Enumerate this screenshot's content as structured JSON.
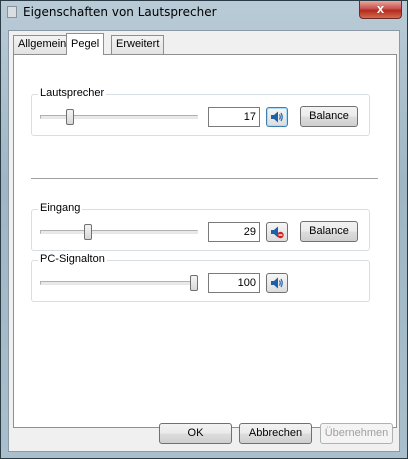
{
  "window": {
    "title": "Eigenschaften von Lautsprecher",
    "close_label": "x"
  },
  "tabs": [
    {
      "label": "Allgemein",
      "active": false
    },
    {
      "label": "Pegel",
      "active": true
    },
    {
      "label": "Erweitert",
      "active": false
    }
  ],
  "groups": {
    "speaker": {
      "label": "Lautsprecher",
      "value": "17",
      "level": 17,
      "balance_label": "Balance",
      "muted": false
    },
    "input": {
      "label": "Eingang",
      "value": "29",
      "level": 29,
      "balance_label": "Balance",
      "muted": true
    },
    "pc_beep": {
      "label": "PC-Signalton",
      "value": "100",
      "level": 100,
      "muted": false
    }
  },
  "footer": {
    "ok_label": "OK",
    "cancel_label": "Abbrechen",
    "apply_label": "Übernehmen",
    "apply_enabled": false
  },
  "colors": {
    "accent": "#3c7fb1",
    "mute": "#d21f1f"
  },
  "icons": {
    "speaker": "speaker-icon",
    "muted": "speaker-muted-icon"
  }
}
